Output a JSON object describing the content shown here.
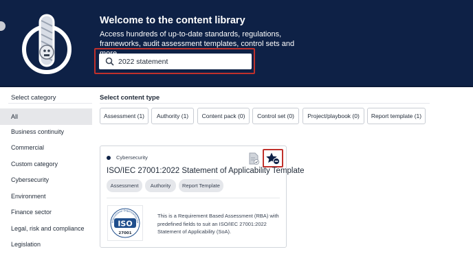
{
  "banner": {
    "title": "Welcome to the content library",
    "description": "Access hundreds of up-to-date standards, regulations, frameworks, audit assessment templates, control sets and more.",
    "colors": {
      "background": "#0e2146",
      "highlight": "#c0302b"
    }
  },
  "search": {
    "value": "2022 statement",
    "placeholder": "",
    "icon": "search-icon"
  },
  "sidebar": {
    "header": "Select category",
    "items": [
      {
        "label": "All",
        "active": true
      },
      {
        "label": "Business continuity",
        "active": false
      },
      {
        "label": "Commercial",
        "active": false
      },
      {
        "label": "Custom category",
        "active": false
      },
      {
        "label": "Cybersecurity",
        "active": false
      },
      {
        "label": "Environment",
        "active": false
      },
      {
        "label": "Finance sector",
        "active": false
      },
      {
        "label": "Legal, risk and compliance",
        "active": false
      },
      {
        "label": "Legislation",
        "active": false
      }
    ]
  },
  "content_types": {
    "header": "Select content type",
    "chips": [
      {
        "label": "Assessment (1)"
      },
      {
        "label": "Authority (1)"
      },
      {
        "label": "Content pack (0)"
      },
      {
        "label": "Control set (0)"
      },
      {
        "label": "Project/playbook (0)"
      },
      {
        "label": "Report template (1)"
      }
    ]
  },
  "results": [
    {
      "category": "Cybersecurity",
      "title": "ISO/IEC 27001:2022 Statement of Applicability Template",
      "tags": [
        "Assessment",
        "Authority",
        "Report Template"
      ],
      "description": "This is a Requirement Based Assessment (RBA) with predefined fields to suit an ISO/IEC 27001:2022 Statement of Applicability (SoA).",
      "logo": {
        "ring_text": "International Organization for Standardization",
        "mark": "ISO",
        "number": "27001"
      },
      "icons": {
        "document": "document-check-icon",
        "favorite": "star-remove-icon"
      }
    }
  ]
}
